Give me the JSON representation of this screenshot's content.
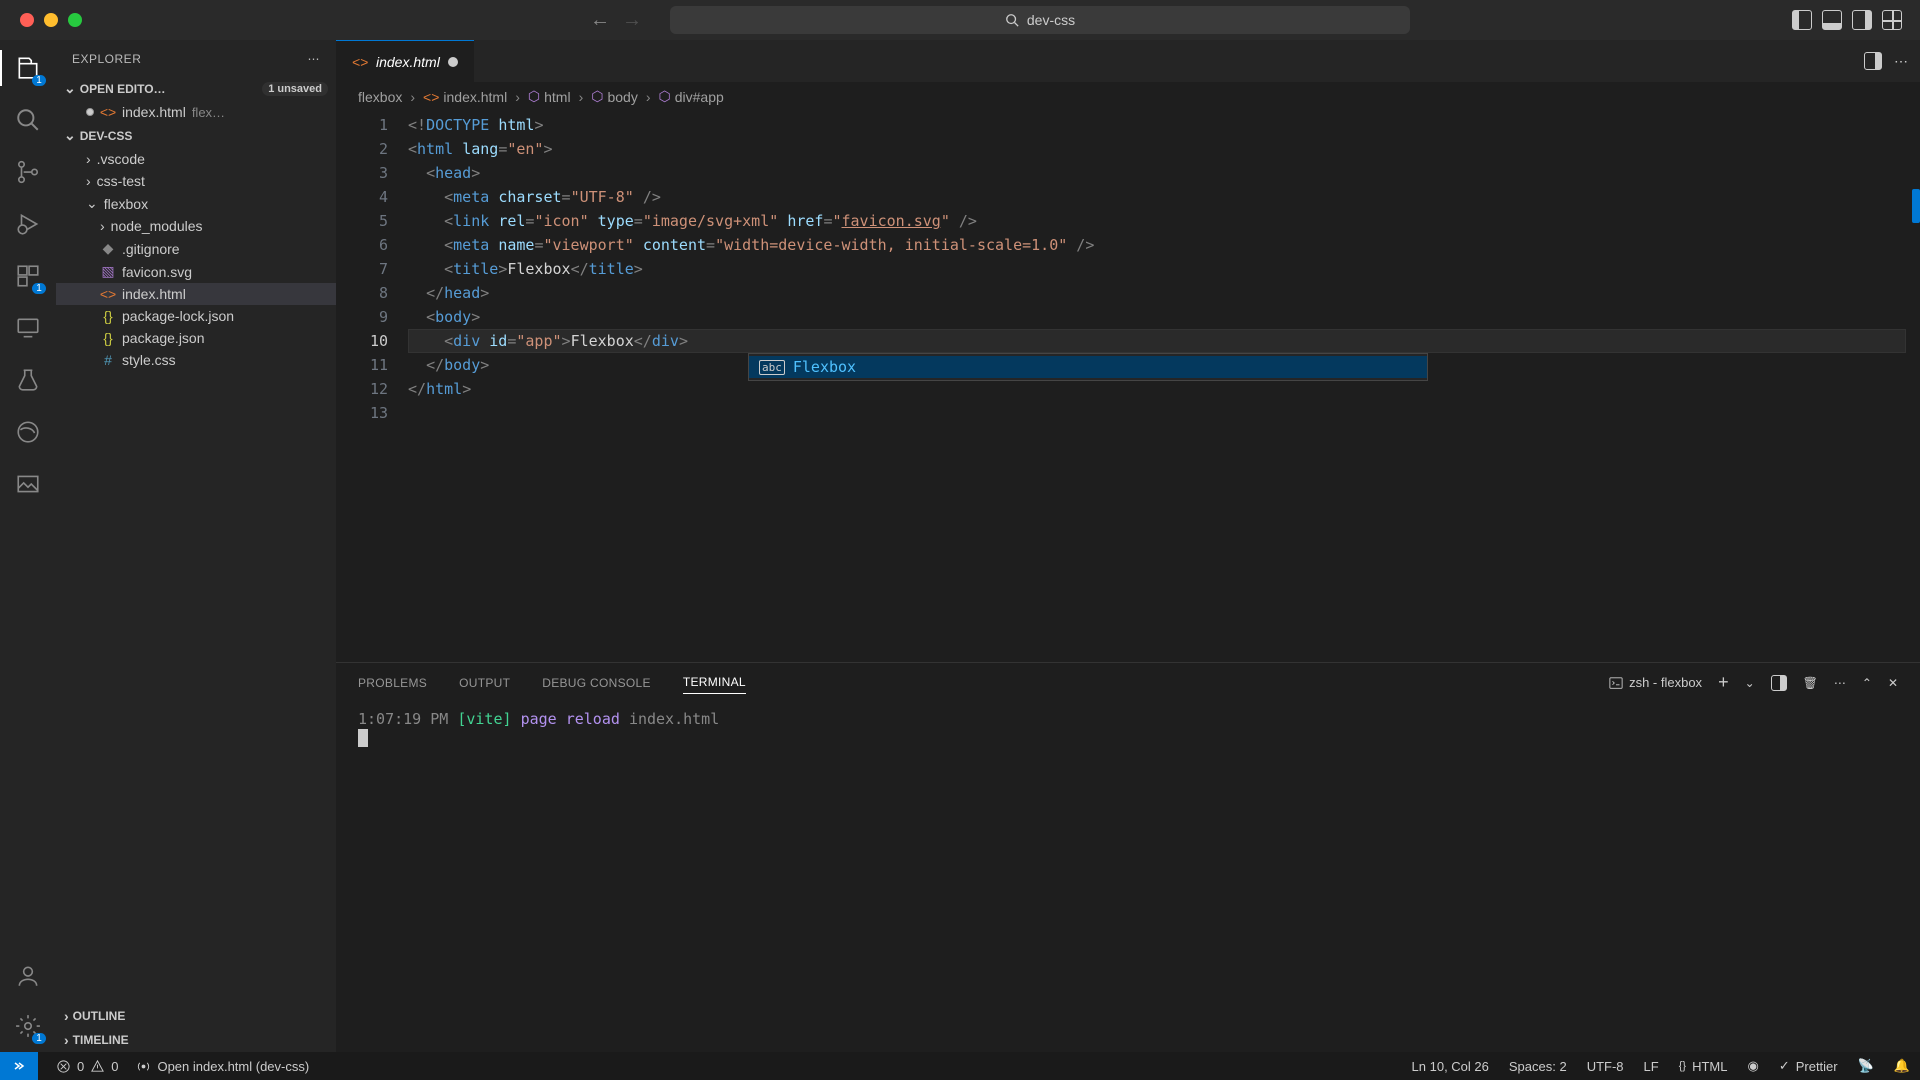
{
  "titlebar": {
    "search": "dev-css"
  },
  "sidebar": {
    "title": "EXPLORER",
    "openEditors": {
      "label": "OPEN EDITO…",
      "badge": "1 unsaved",
      "file": "index.html",
      "folder": "flex…"
    },
    "project": "DEV-CSS",
    "tree": [
      {
        "name": ".vscode",
        "icon": "chev"
      },
      {
        "name": "css-test",
        "icon": "chev"
      },
      {
        "name": "flexbox",
        "icon": "chev-open"
      },
      {
        "name": "node_modules",
        "icon": "chev",
        "indent": 2
      },
      {
        "name": ".gitignore",
        "icon": "git",
        "indent": 2
      },
      {
        "name": "favicon.svg",
        "icon": "svg",
        "indent": 2
      },
      {
        "name": "index.html",
        "icon": "html",
        "indent": 2,
        "selected": true
      },
      {
        "name": "package-lock.json",
        "icon": "json",
        "indent": 2
      },
      {
        "name": "package.json",
        "icon": "json",
        "indent": 2
      },
      {
        "name": "style.css",
        "icon": "css",
        "indent": 2
      }
    ],
    "outline": "OUTLINE",
    "timeline": "TIMELINE"
  },
  "tab": {
    "filename": "index.html"
  },
  "breadcrumbs": [
    "flexbox",
    "index.html",
    "html",
    "body",
    "div#app"
  ],
  "code": {
    "lines": 13,
    "currentLine": 10
  },
  "autocomplete": {
    "kind": "abc",
    "text": "Flexbox"
  },
  "panel": {
    "tabs": [
      "PROBLEMS",
      "OUTPUT",
      "DEBUG CONSOLE",
      "TERMINAL"
    ],
    "active": 3,
    "shell": "zsh - flexbox",
    "time": "1:07:19 PM",
    "vite": "[vite]",
    "msg1": "page",
    "msg2": "reload",
    "path": "index.html"
  },
  "status": {
    "errors": "0",
    "warnings": "0",
    "port": "Open index.html (dev-css)",
    "position": "Ln 10, Col 26",
    "spaces": "Spaces: 2",
    "encoding": "UTF-8",
    "eol": "LF",
    "lang": "HTML",
    "prettier": "Prettier"
  },
  "activity": {
    "explorer_badge": "1",
    "ext_badge": "1",
    "gear_badge": "1"
  }
}
